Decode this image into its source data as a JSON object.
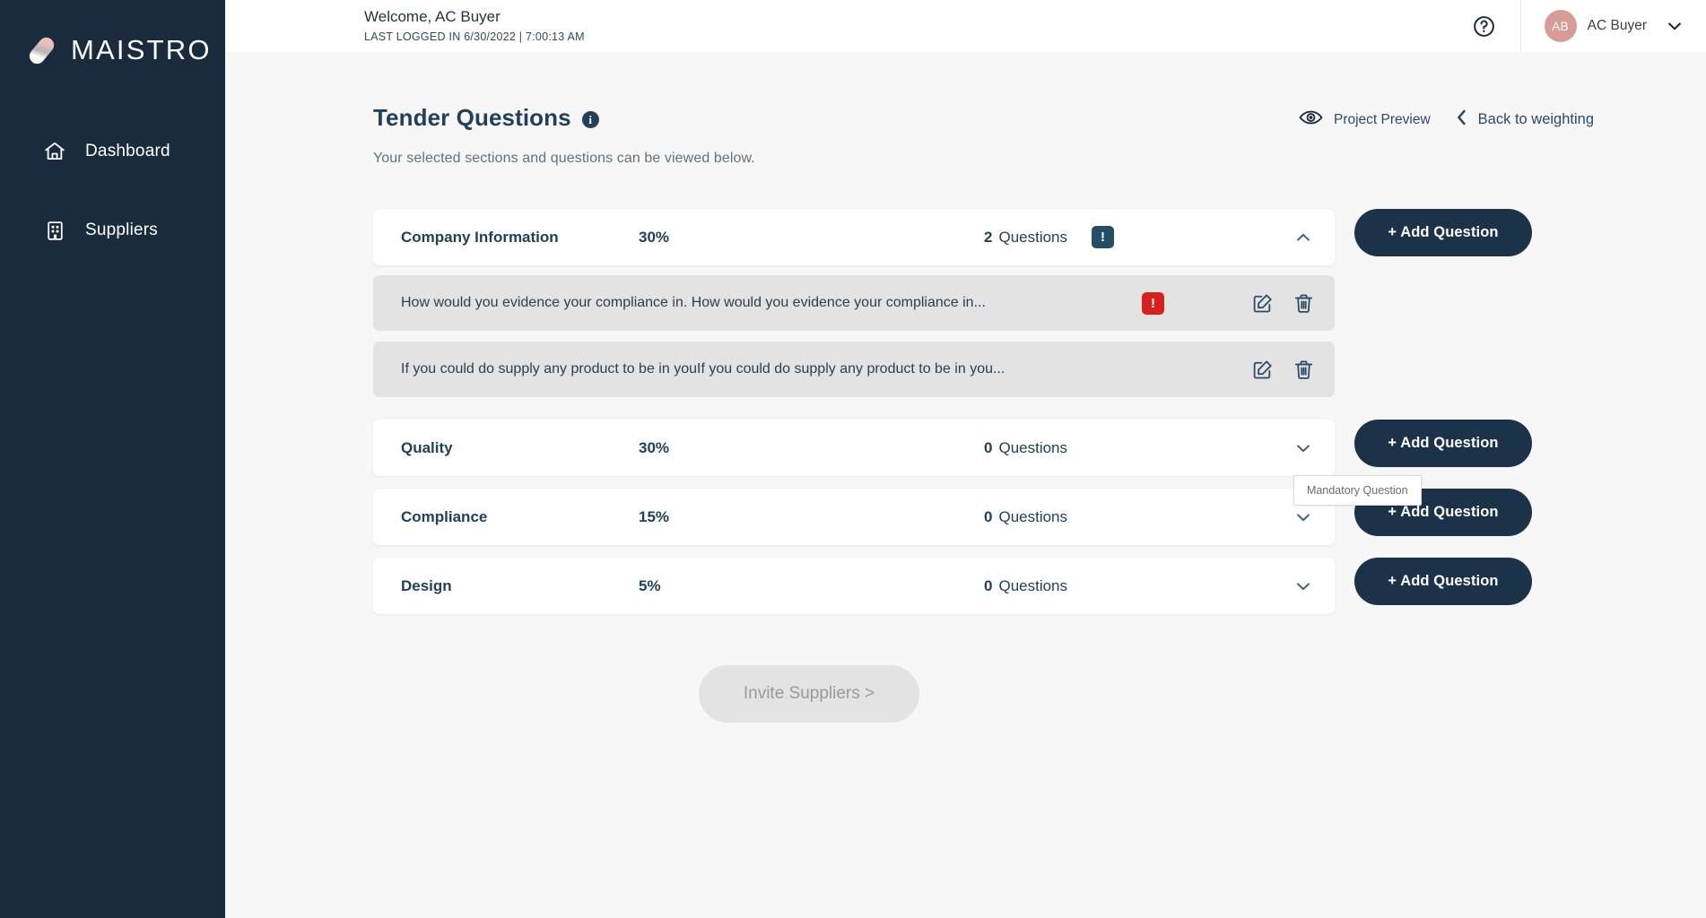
{
  "brand": {
    "name": "MAISTRO",
    "logo_icon": "capsule-logo-icon",
    "sidebar_color": "#1a2b3d",
    "accent_pink": "#d69c95"
  },
  "sidebar": {
    "items": [
      {
        "label": "Dashboard",
        "icon": "home-icon"
      },
      {
        "label": "Suppliers",
        "icon": "building-icon"
      }
    ]
  },
  "topbar": {
    "welcome": "Welcome, AC Buyer",
    "last_logged_in": "LAST LOGGED IN 6/30/2022 | 7:00:13 AM",
    "help_icon": "question-circle-icon",
    "avatar_initials": "AB",
    "user_name": "AC Buyer",
    "caret_icon": "chevron-down-icon"
  },
  "page": {
    "title": "Tender Questions",
    "info_icon": "info-icon",
    "info_glyph": "i",
    "subtitle": "Your selected sections and questions can be viewed below.",
    "preview_label": "Project Preview",
    "preview_icon": "eye-icon",
    "back_label": "Back to weighting",
    "back_icon": "chevron-left-icon"
  },
  "labels": {
    "questions_word": "Questions",
    "add_question": "+ Add Question",
    "mandatory_glyph": "!",
    "section_flag_glyph": "!",
    "edit_icon": "edit-pencil-icon",
    "delete_icon": "trash-icon",
    "chevron_up_icon": "chevron-up-icon",
    "chevron_down_icon": "chevron-down-icon"
  },
  "tooltip": {
    "text": "Mandatory Question",
    "visible": true
  },
  "sections": [
    {
      "name": "Company Information",
      "weight": "30%",
      "count": "2",
      "expanded": true,
      "has_flag": true,
      "questions": [
        {
          "text": "How would you evidence your compliance in. How would you evidence your compliance in...",
          "mandatory": true
        },
        {
          "text": "If you could do supply any product to be in youIf you could do supply any product to be in you...",
          "mandatory": false
        }
      ]
    },
    {
      "name": "Quality",
      "weight": "30%",
      "count": "0",
      "expanded": false,
      "has_flag": false,
      "questions": []
    },
    {
      "name": "Compliance",
      "weight": "15%",
      "count": "0",
      "expanded": false,
      "has_flag": false,
      "questions": []
    },
    {
      "name": "Design",
      "weight": "5%",
      "count": "0",
      "expanded": false,
      "has_flag": false,
      "questions": []
    }
  ],
  "cta": {
    "label": "Invite Suppliers >",
    "disabled": true
  }
}
